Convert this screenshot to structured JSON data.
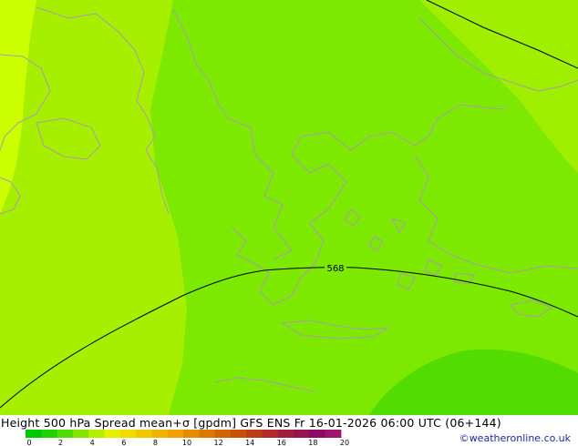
{
  "map": {
    "contour_label": "568",
    "colors": {
      "far_left_band": "#ccff00",
      "left_band": "#a6ef00",
      "center_band": "#7de800",
      "right_band": "#a0ef00",
      "bottom_right_blob": "#52dc00",
      "coastline": "#a89ca8",
      "contour_line": "#000000"
    }
  },
  "footer": {
    "title": "Height 500 hPa Spread mean+σ [gpdm] GFS ENS Fr 16-01-2026 06:00 UTC (06+144)",
    "credit": "©weatheronline.co.uk",
    "legend": {
      "ticks": [
        "0",
        "2",
        "4",
        "6",
        "8",
        "10",
        "12",
        "14",
        "16",
        "18",
        "20"
      ],
      "colors": [
        "#00c800",
        "#20d200",
        "#50dc00",
        "#82e600",
        "#b4f000",
        "#e6f000",
        "#f0dc00",
        "#f0c800",
        "#f0b400",
        "#f0a000",
        "#e68c00",
        "#dc7800",
        "#d26400",
        "#c85000",
        "#be3c14",
        "#b42828",
        "#a01e3c",
        "#961450",
        "#8c0a64",
        "#a0146e"
      ]
    }
  }
}
